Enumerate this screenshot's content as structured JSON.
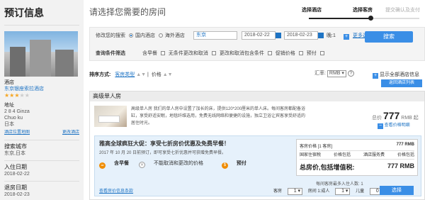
{
  "sidebar": {
    "title": "预订信息",
    "hotel_label": "酒店",
    "hotel_name": "东京银座索拉酒店",
    "stars": "★★★",
    "stars_off": "★★",
    "address_label": "地址",
    "address_lines": [
      "2 8 4 Ginza",
      "Chuo ku",
      "日本"
    ],
    "view_map": "酒店位置地图",
    "more_hotel": "更改酒店",
    "search_city_label": "搜索城市",
    "search_city": "东京,日本",
    "checkin_label": "入住日期",
    "checkin": "2018-02-22",
    "checkout_label": "退房日期",
    "checkout": "2018-02-23"
  },
  "header": {
    "title": "请选择您需要的房间",
    "steps": [
      "选择酒店",
      "选择客房",
      "提交确认及支付"
    ]
  },
  "search": {
    "label": "修改您的搜索",
    "opt_domestic": "国内酒店",
    "opt_overseas": "海外酒店",
    "city": "东京",
    "date_in": "2018-02-22",
    "date_out": "2018-02-23",
    "nights": "晚:1",
    "more": "更多选择",
    "button": "搜索",
    "filter_label": "查询条件筛选",
    "filters": [
      "含早餐",
      "无条件更改和取消",
      "更改和取消包含条件",
      "促销价格",
      "预付"
    ]
  },
  "sort": {
    "label": "排序方式:",
    "opt_room": "客房类型",
    "opt_price": "价格",
    "currency_label": "汇率:",
    "currency": "RMB",
    "show_all": "显示全部酒店信息",
    "back_list": "返回酒店列表"
  },
  "room": {
    "name": "高级单人房",
    "desc": "高级单人房 我们的单人房中设置了加长的床，提供120*200厘米的单人床。每间客房都配备浴缸，享受舒适安眠，地毯纤维选用，免费无线网络和便捷的设施，独立卫浴让宾客享受舒适的居住时光。",
    "price_prefix": "总价",
    "price": "777",
    "price_unit": "RMB 起",
    "breakdown": "查看价格明细",
    "offer_title": "雅高全球疯狂大促：享受七折房价优惠及免费早餐！",
    "offer_desc": "2017 年 10 月 20 日前预订，即可享受七折优惠并可获赠免费早餐。",
    "feat_breakfast": "含早餐",
    "feat_nochange": "不能取消和更改的价格",
    "feat_prepay": "预付",
    "terms": "查看房价信息条款",
    "table": {
      "col1": "客房价格 [1 客房]",
      "col1_val": "777 RMB",
      "tax": "国家住宿税",
      "tax_val": "价格包括",
      "svc": "酒店服务费",
      "svc_val": "价格包括",
      "total": "总房价,包括增值税:",
      "total_val": "777 RMB"
    },
    "occupancy": "每间客房最多入住人数: 1",
    "rooms_label": "客房",
    "rooms": "1",
    "room1_label": "房间 1:成人",
    "adults": "1",
    "children_label": "儿童",
    "children": "0",
    "choose": "选择"
  },
  "colors": {
    "accent": "#3a8ee6",
    "link": "#1f74c4",
    "star": "#f5a623"
  }
}
